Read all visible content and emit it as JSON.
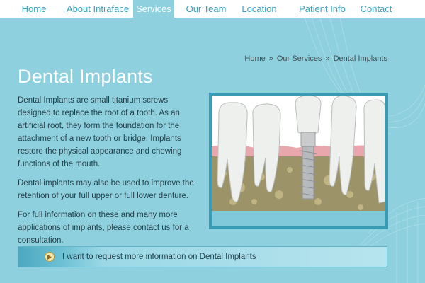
{
  "nav": {
    "items": [
      {
        "label": "Home",
        "active": false
      },
      {
        "label": "About Intraface",
        "active": false
      },
      {
        "label": "Services",
        "active": true
      },
      {
        "label": "Our Team",
        "active": false
      },
      {
        "label": "Location",
        "active": false
      },
      {
        "label": "Patient Info",
        "active": false
      },
      {
        "label": "Contact",
        "active": false
      }
    ]
  },
  "breadcrumb": {
    "items": [
      "Home",
      "Our Services",
      "Dental Implants"
    ],
    "separator": "»"
  },
  "page": {
    "title": "Dental Implants",
    "paragraphs": [
      "Dental Implants are small titanium screws designed to replace the root of a tooth. As an artificial root, they form the foundation for the attachment of a new tooth or bridge. Implants restore the physical appearance and chewing functions of the mouth.",
      "Dental implants may also be used to improve the retention of your full upper or full lower denture.",
      "For full information on these and many more applications of implants, please contact us for a consultation."
    ]
  },
  "cta": {
    "label": "I want to request more information on Dental Implants",
    "icon": "play-circle-icon"
  },
  "colors": {
    "background": "#8fd0df",
    "nav_background": "#ffffff",
    "nav_text": "#3aa3c1",
    "nav_active_background": "#8fd0df",
    "title": "#ffffff",
    "body_text": "#1f3d48",
    "frame": "#3a9bb5"
  }
}
